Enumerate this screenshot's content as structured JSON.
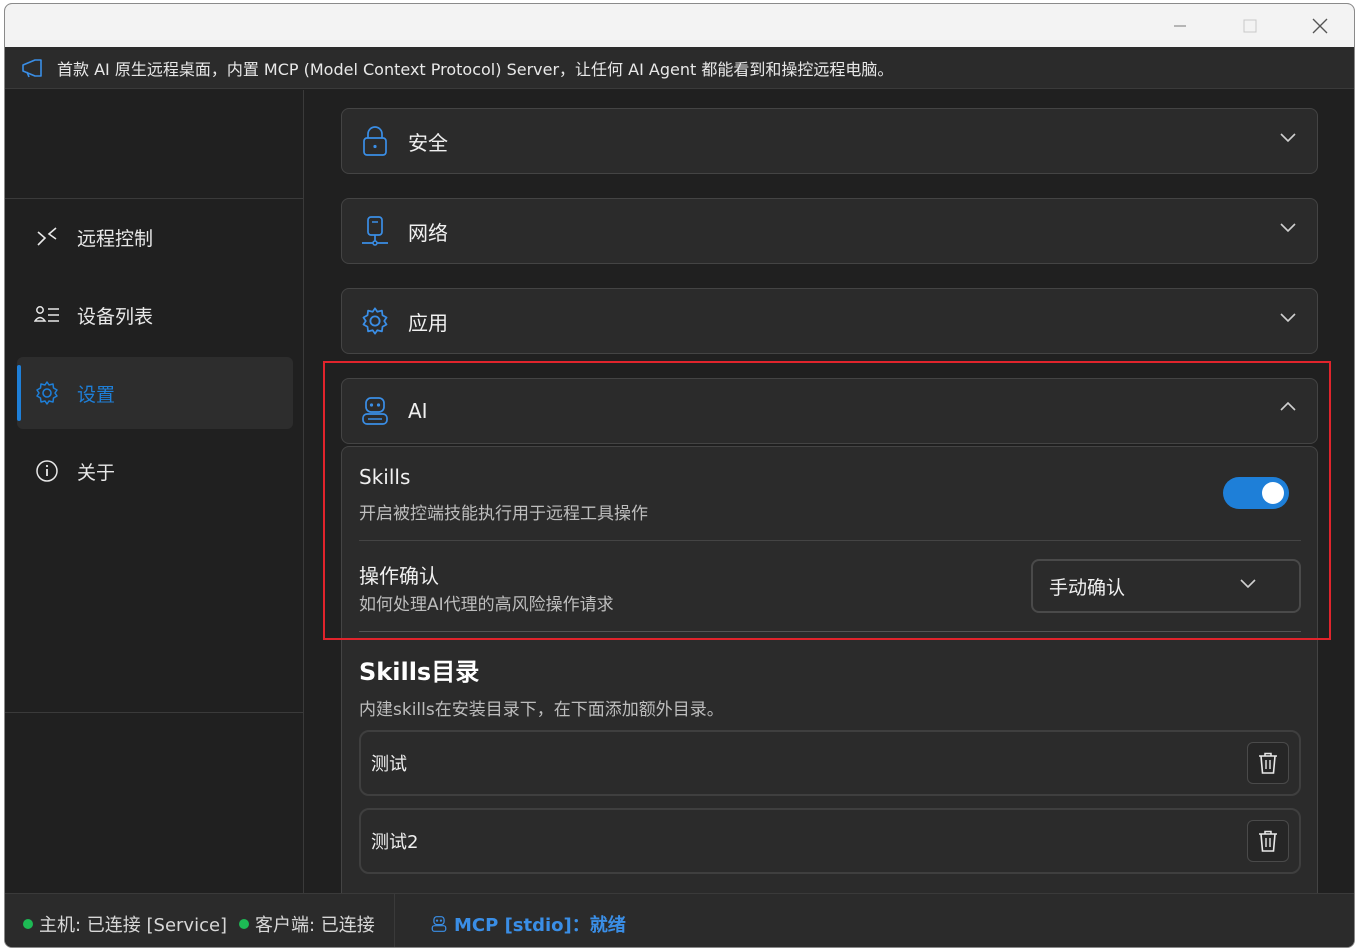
{
  "window": {
    "banner_text": "首款 AI 原生远程桌面，内置 MCP (Model Context Protocol) Server，让任何 AI Agent 都能看到和操控远程电脑。"
  },
  "sidebar": {
    "items": [
      {
        "label": "远程控制",
        "icon": "remote-control-icon"
      },
      {
        "label": "设备列表",
        "icon": "device-list-icon"
      },
      {
        "label": "设置",
        "icon": "gear-icon",
        "active": true
      },
      {
        "label": "关于",
        "icon": "info-icon"
      }
    ]
  },
  "settings": {
    "sections": [
      {
        "label": "安全",
        "icon": "lock-icon",
        "expanded": false
      },
      {
        "label": "网络",
        "icon": "network-icon",
        "expanded": false
      },
      {
        "label": "应用",
        "icon": "gear-icon",
        "expanded": false
      },
      {
        "label": "AI",
        "icon": "robot-icon",
        "expanded": true
      }
    ],
    "ai": {
      "skills_title": "Skills",
      "skills_desc": "开启被控端技能执行用于远程工具操作",
      "skills_enabled": true,
      "confirm_title": "操作确认",
      "confirm_desc": "如何处理AI代理的高风险操作请求",
      "confirm_value": "手动确认",
      "dir_title": "Skills目录",
      "dir_desc": "内建skills在安装目录下，在下面添加额外目录。",
      "dirs": [
        "测试",
        "测试2"
      ]
    }
  },
  "status": {
    "host": "主机: 已连接 [Service]",
    "client": "客户端: 已连接",
    "mcp": "MCP [stdio]：就绪"
  },
  "colors": {
    "accent": "#1e7fd8",
    "connected": "#1db954",
    "highlight": "#e0242c"
  }
}
